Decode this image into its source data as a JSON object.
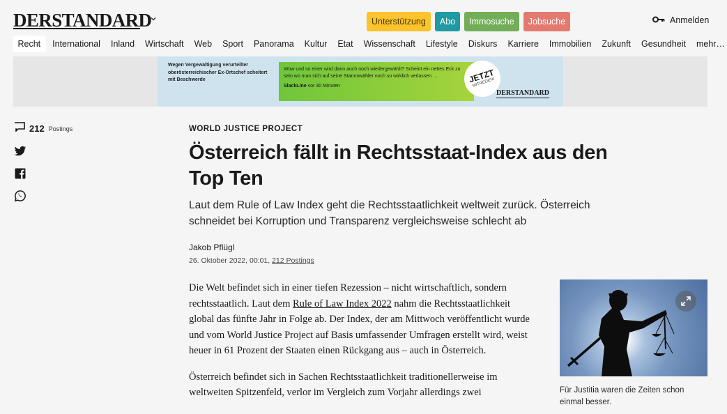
{
  "header": {
    "logo": "DERSTANDARD",
    "pills": {
      "support": "Unterstützung",
      "abo": "Abo",
      "immo": "Immosuche",
      "job": "Jobsuche"
    },
    "login": "Anmelden"
  },
  "nav": {
    "items": [
      "Recht",
      "International",
      "Inland",
      "Wirtschaft",
      "Web",
      "Sport",
      "Panorama",
      "Kultur",
      "Etat",
      "Wissenschaft",
      "Lifestyle",
      "Diskurs",
      "Karriere",
      "Immobilien",
      "Zukunft",
      "Gesundheit",
      "mehr…"
    ],
    "active": "Recht"
  },
  "banner": {
    "left_text": "Wegen Vergewaltigung verurteilter oberösterreichischer Ex-Ortschef scheitert mit Beschwerde",
    "green_text": "Wow und so einer wird dann auch noch wiedergewählt? Scheint ein nettes Eck zu sein wo man sich auf seine Stammwähler noch so wirklich verlassen …",
    "source": "SlackLine",
    "source_time": "vor 30 Minuten",
    "cta_big": "JETZT",
    "cta_small": "MITREDEN!",
    "logo": "DERSTANDARD"
  },
  "social": {
    "postings_count": "212",
    "postings_label": "Postings",
    "icons": [
      "twitter-icon",
      "facebook-icon",
      "whatsapp-icon"
    ]
  },
  "article": {
    "kicker": "WORLD JUSTICE PROJECT",
    "headline": "Österreich fällt in Rechtsstaat-Index aus den Top Ten",
    "lead": "Laut dem Rule of Law Index geht die Rechtsstaatlichkeit weltweit zurück. Österreich schneidet bei Korruption und Transparenz vergleichsweise schlecht ab",
    "author": "Jakob Pflügl",
    "date": "26. Oktober 2022, 00:01,",
    "postings_link": "212 Postings",
    "p1_a": "Die Welt befindet sich in einer tiefen Rezession – nicht wirtschaftlich, sondern rechtsstaatlich. Laut dem ",
    "p1_link": "Rule of Law Index 2022",
    "p1_b": " nahm die Rechtsstaatlichkeit global das fünfte Jahr in Folge ab. Der Index, der am Mittwoch veröffentlicht wurde und vom World Justice Project auf Basis umfassender Umfragen erstellt wird, weist heuer in 61 Prozent der Staaten einen Rückgang aus – auch in Österreich.",
    "p2": "Österreich befindet sich in Sachen Rechtsstaatlichkeit traditionellerweise im weltweiten Spitzenfeld, verlor im Vergleich zum Vorjahr allerdings zwei"
  },
  "figure": {
    "caption": "Für Justitia waren die Zeiten schon einmal besser."
  }
}
